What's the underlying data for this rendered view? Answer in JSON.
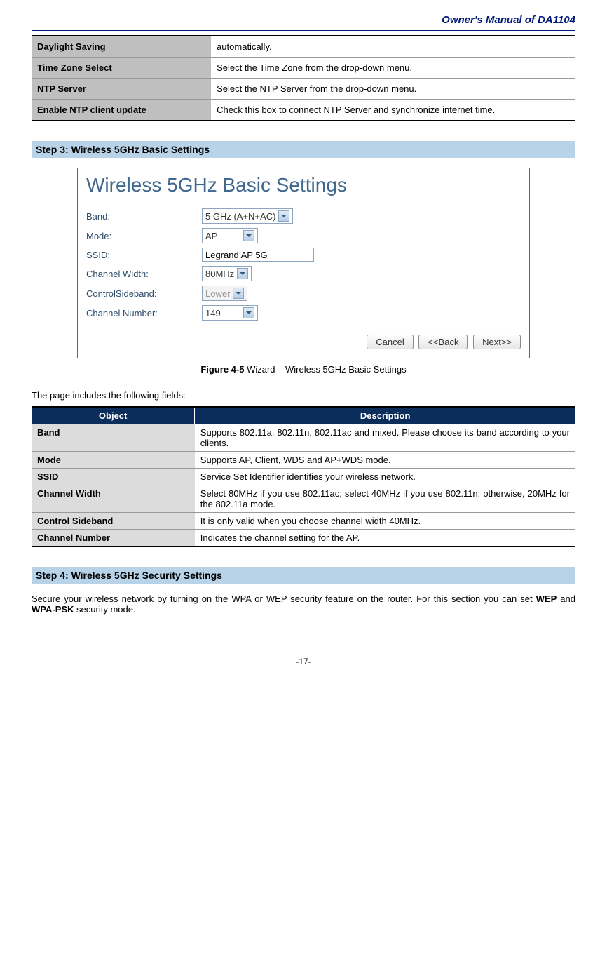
{
  "header": "Owner's Manual of DA1104",
  "table1": {
    "rows": [
      {
        "obj": "Daylight Saving",
        "desc": "automatically."
      },
      {
        "obj": "Time Zone Select",
        "desc": "Select the Time Zone from the drop-down menu."
      },
      {
        "obj": "NTP Server",
        "desc": "Select the NTP Server from the drop-down menu."
      },
      {
        "obj": "Enable NTP client update",
        "desc": "Check this box to connect NTP Server and synchronize internet time."
      }
    ]
  },
  "step3": {
    "title": "Step 3: Wireless 5GHz Basic Settings",
    "panel_title": "Wireless 5GHz Basic Settings",
    "fields": {
      "band": {
        "label": "Band:",
        "value": "5 GHz (A+N+AC)"
      },
      "mode": {
        "label": "Mode:",
        "value": "AP"
      },
      "ssid": {
        "label": "SSID:",
        "value": "Legrand AP 5G"
      },
      "chwidth": {
        "label": "Channel Width:",
        "value": "80MHz"
      },
      "sideband": {
        "label": "ControlSideband:",
        "value": "Lower"
      },
      "chnum": {
        "label": "Channel Number:",
        "value": "149"
      }
    },
    "buttons": {
      "cancel": "Cancel",
      "back": "<<Back",
      "next": "Next>>"
    },
    "caption_bold": "Figure 4-5",
    "caption_rest": " Wizard – Wireless 5GHz Basic Settings"
  },
  "fields_intro": "The page includes the following fields:",
  "table2": {
    "header": {
      "obj": "Object",
      "desc": "Description"
    },
    "rows": [
      {
        "obj": "Band",
        "desc": "Supports 802.11a, 802.11n, 802.11ac and mixed. Please choose its band according to your clients."
      },
      {
        "obj": "Mode",
        "desc": "Supports AP, Client, WDS and AP+WDS mode."
      },
      {
        "obj": "SSID",
        "desc": "Service Set Identifier identifies your wireless network."
      },
      {
        "obj": "Channel Width",
        "desc": "Select 80MHz if you use 802.11ac; select 40MHz if you use 802.11n; otherwise, 20MHz for the 802.11a mode."
      },
      {
        "obj": "Control Sideband",
        "desc": "It is only valid when you choose channel width 40MHz."
      },
      {
        "obj": "Channel Number",
        "desc": "Indicates the channel setting for the AP."
      }
    ]
  },
  "step4": {
    "title": "Step 4: Wireless 5GHz Security Settings",
    "para_pre": "Secure your wireless network by turning on the WPA or WEP security feature on the router. For this section you can set ",
    "bold1": "WEP",
    "mid": " and ",
    "bold2": "WPA-PSK",
    "para_post": " security mode."
  },
  "footer": "-17-"
}
